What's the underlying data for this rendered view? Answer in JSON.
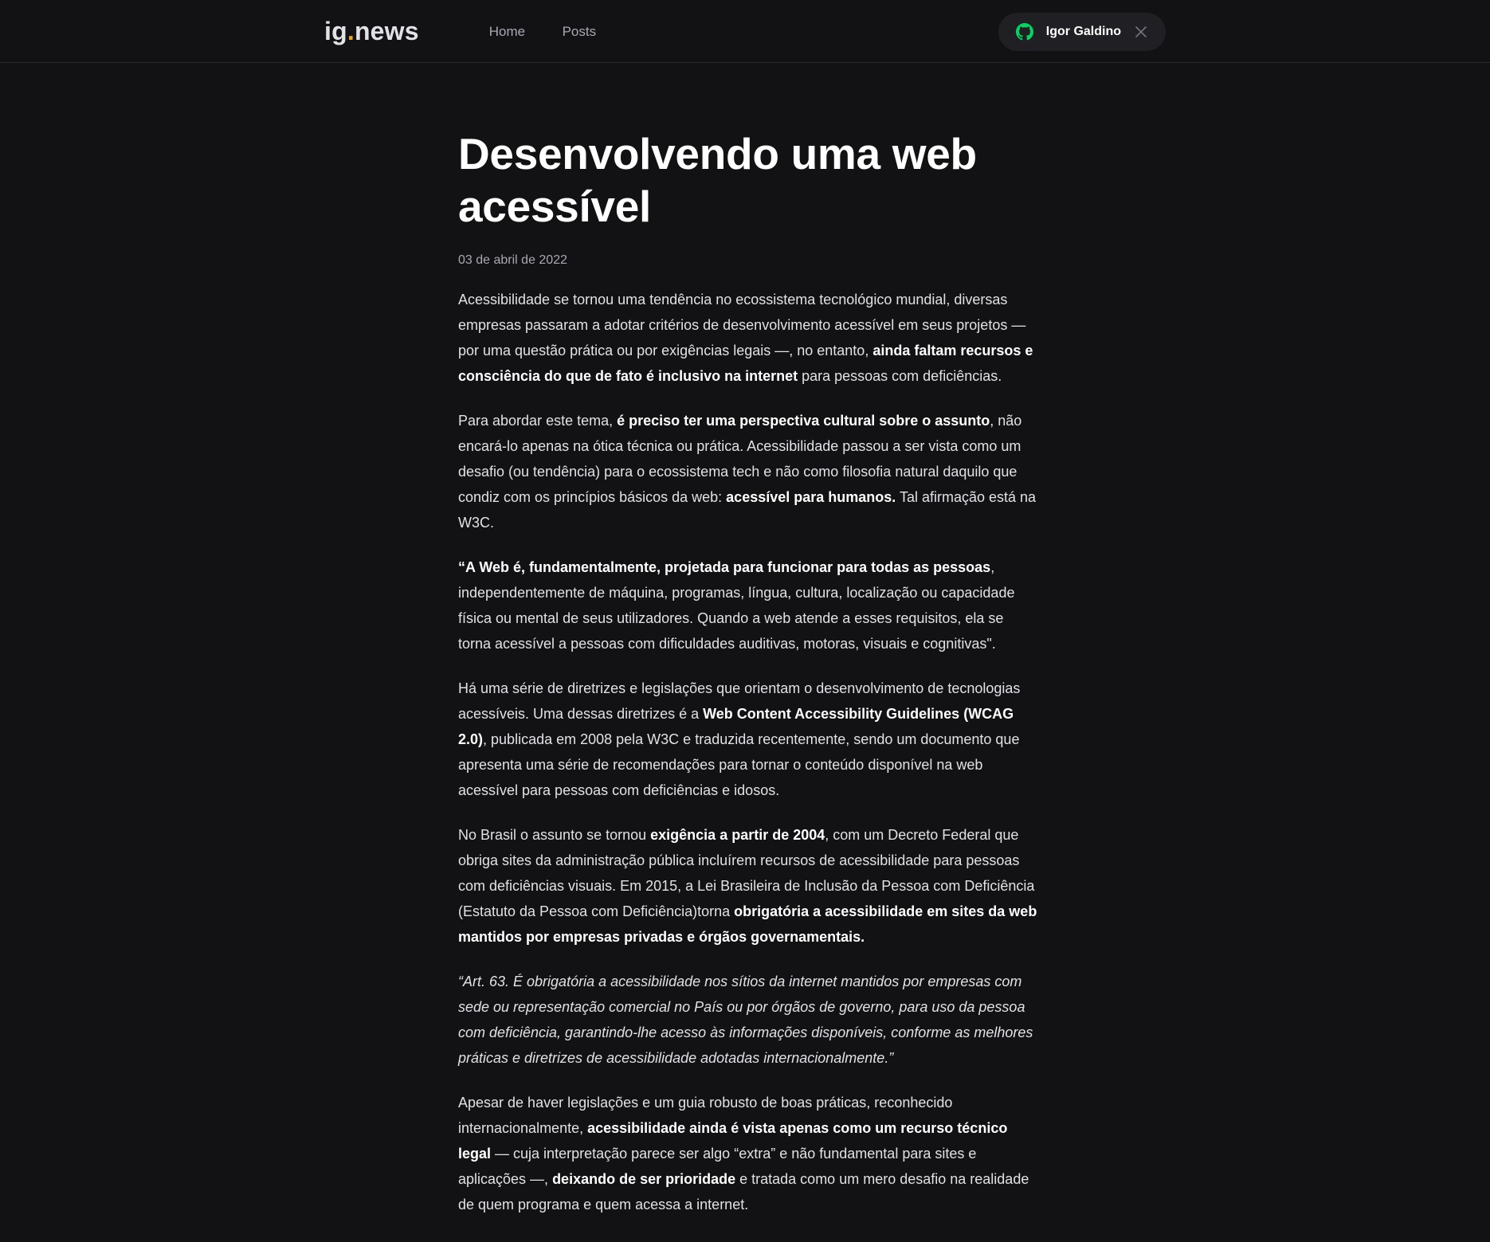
{
  "header": {
    "logo_main": "ig",
    "logo_dot": ".",
    "logo_rest": "news",
    "nav": {
      "home": "Home",
      "posts": "Posts"
    },
    "user": {
      "name": "Igor Galdino",
      "icon": "github-icon",
      "icon_color": "#04d361"
    }
  },
  "post": {
    "title": "Desenvolvendo uma web acessível",
    "date": "03 de abril de 2022",
    "p1": {
      "t1": "Acessibilidade se tornou uma tendência no ecossistema tecnológico mundial, diversas empresas passaram a adotar critérios de desenvolvimento acessível em seus projetos — por uma questão prática ou por exigências legais —, no entanto, ",
      "b1": "ainda faltam recursos e consciência do que de fato é inclusivo na internet",
      "t2": " para pessoas com deficiências."
    },
    "p2": {
      "t1": "Para abordar este tema, ",
      "b1": "é preciso ter uma perspectiva cultural sobre o assunto",
      "t2": ", não encará-lo apenas na ótica técnica ou prática. Acessibilidade passou a ser vista como um desafio (ou tendência) para o ecossistema tech e não como filosofia natural daquilo que condiz com os princípios básicos da web: ",
      "b2": "acessível para humanos.",
      "t3": " Tal afirmação está na W3C."
    },
    "p3": {
      "b1": "“A Web é, fundamentalmente, projetada para funcionar para todas as pessoas",
      "t1": ", independentemente de máquina, programas, língua, cultura, localização ou capacidade física ou mental de seus utilizadores. Quando a web atende a esses requisitos, ela se torna acessível a pessoas com dificuldades auditivas, motoras, visuais e cognitivas\"."
    },
    "p4": {
      "t1": "Há uma série de diretrizes e legislações que orientam o desenvolvimento de tecnologias acessíveis. Uma dessas diretrizes é a ",
      "b1": "Web Content Accessibility Guidelines (WCAG 2.0)",
      "t2": ", publicada em 2008 pela W3C e traduzida recentemente, sendo um documento que apresenta uma série de recomendações para tornar o conteúdo disponível na web acessível para pessoas com deficiências e idosos."
    },
    "p5": {
      "t1": "No Brasil o assunto se tornou ",
      "b1": "exigência a partir de 2004",
      "t2": ", com um Decreto Federal que obriga sites da administração pública incluírem recursos de acessibilidade para pessoas com deficiências visuais. Em 2015, a Lei Brasileira de Inclusão da Pessoa com Deficiência (Estatuto da Pessoa com Deficiência)torna ",
      "b2": "obrigatória a acessibilidade em sites da web mantidos por empresas privadas e órgãos governamentais."
    },
    "p6": {
      "i1": "“Art. 63. É obrigatória a acessibilidade nos sítios da internet mantidos por empresas com sede ou representação comercial no País ou por órgãos de governo, para uso da pessoa com deficiência, garantindo-lhe acesso às informações disponíveis, conforme as melhores práticas e diretrizes de acessibilidade adotadas internacionalmente.”"
    },
    "p7": {
      "t1": "Apesar de haver legislações e um guia robusto de boas práticas, reconhecido internacionalmente, ",
      "b1": "acessibilidade ainda é vista apenas como um recurso técnico legal",
      "t2": " — cuja interpretação parece ser algo “extra” e não fundamental para sites e aplicações —, ",
      "b2": "deixando de ser prioridade",
      "t3": " e tratada como um mero desafio na realidade de quem programa e quem acessa a internet."
    }
  }
}
